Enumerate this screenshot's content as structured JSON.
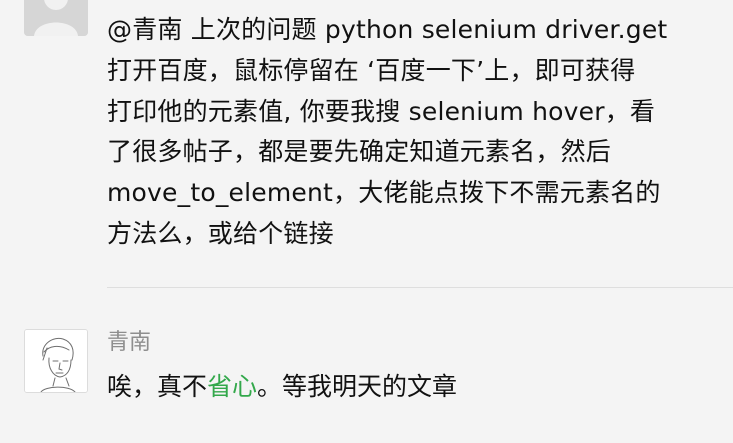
{
  "comment": {
    "avatar_icon": "default-user-avatar-icon",
    "lines": [
      "@青南  上次的问题 python selenium driver.get",
      "打开百度，鼠标停留在 ‘百度一下’上，即可获得",
      "打印他的元素值, 你要我搜 selenium hover，看",
      "了很多帖子，都是要先确定知道元素名，然后",
      "move_to_element，大佬能点拨下不需元素名的",
      "方法么，或给个链接"
    ]
  },
  "reply": {
    "avatar_icon": "sketch-portrait-avatar-icon",
    "author": "青南",
    "text_before": "唉，真不",
    "text_highlight": "省心",
    "text_after": "。等我明天的文章",
    "highlight_color": "#33a84b"
  }
}
